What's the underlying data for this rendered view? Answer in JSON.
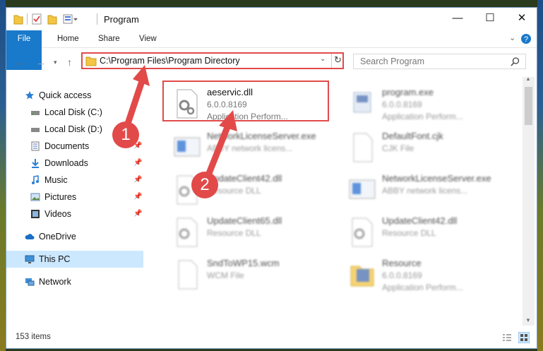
{
  "window": {
    "title": "Program"
  },
  "controls": {
    "minimize": "—",
    "maximize": "☐",
    "close": "✕"
  },
  "ribbon": {
    "tabs": [
      "File",
      "Home",
      "Share",
      "View"
    ]
  },
  "address": {
    "path": "C:\\Program Files\\Program Directory"
  },
  "search": {
    "placeholder": "Search Program"
  },
  "sidebar": {
    "items": [
      {
        "label": "Quick access",
        "icon": "star-icon"
      },
      {
        "label": "Local Disk (C:)",
        "icon": "drive-icon"
      },
      {
        "label": "Local Disk (D:)",
        "icon": "drive-icon"
      },
      {
        "label": "Documents",
        "icon": "documents-icon"
      },
      {
        "label": "Downloads",
        "icon": "download-icon"
      },
      {
        "label": "Music",
        "icon": "music-icon"
      },
      {
        "label": "Pictures",
        "icon": "pictures-icon"
      },
      {
        "label": "Videos",
        "icon": "videos-icon"
      },
      {
        "label": "OneDrive",
        "icon": "cloud-icon"
      },
      {
        "label": "This PC",
        "icon": "monitor-icon"
      },
      {
        "label": "Network",
        "icon": "network-icon"
      }
    ]
  },
  "files": [
    {
      "name": "aeservic.dll",
      "meta1": "6.0.0.8169",
      "meta2": "Application Perform..."
    },
    {
      "name": "program.exe",
      "meta1": "6.0.0.8169",
      "meta2": "Application Perform..."
    },
    {
      "name": "NetworkLicenseServer.exe",
      "meta1": "ABBY network licens...",
      "meta2": ""
    },
    {
      "name": "DefaultFont.cjk",
      "meta1": "CJK File",
      "meta2": ""
    },
    {
      "name": "UpdateClient42.dll",
      "meta1": "Resource DLL",
      "meta2": ""
    },
    {
      "name": "NetworkLicenseServer.exe",
      "meta1": "ABBY network licens...",
      "meta2": ""
    },
    {
      "name": "UpdateClient65.dll",
      "meta1": "Resource DLL",
      "meta2": ""
    },
    {
      "name": "UpdateClient42.dll",
      "meta1": "Resource DLL",
      "meta2": ""
    },
    {
      "name": "SndToWP15.wcm",
      "meta1": "WCM File",
      "meta2": ""
    },
    {
      "name": "Resource",
      "meta1": "6.0.0.8169",
      "meta2": "Application Perform..."
    }
  ],
  "status": {
    "count": "153 items"
  },
  "annotations": {
    "step1": "1",
    "step2": "2"
  },
  "colors": {
    "accent": "#1979ca",
    "highlight": "#e24a4a"
  }
}
